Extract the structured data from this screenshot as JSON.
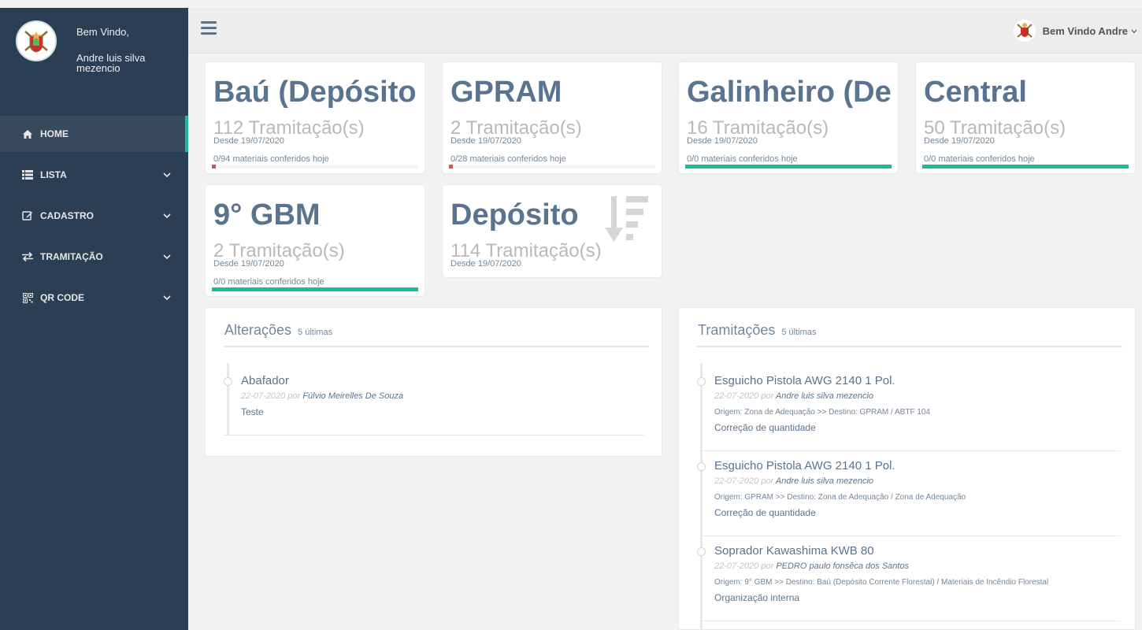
{
  "sidebar": {
    "welcome": "Bem Vindo,",
    "user_name": "Andre luis silva mezencio",
    "menu": [
      {
        "label": "HOME",
        "icon": "home-icon"
      },
      {
        "label": "LISTA",
        "icon": "list-icon"
      },
      {
        "label": "CADASTRO",
        "icon": "edit-icon"
      },
      {
        "label": "TRAMITAÇÃO",
        "icon": "exchange-icon"
      },
      {
        "label": "QR CODE",
        "icon": "qrcode-icon"
      }
    ]
  },
  "topbar": {
    "user_label": "Bem Vindo Andre"
  },
  "tiles": [
    {
      "title": "Baú (Depósito",
      "count": "112 Tramitação(s)",
      "since": "Desde 19/07/2020",
      "checked": "0/94 materiais conferidos hoje",
      "progress": 0.0
    },
    {
      "title": "GPRAM",
      "count": "2 Tramitação(s)",
      "since": "Desde 19/07/2020",
      "checked": "0/28 materiais conferidos hoje",
      "progress": 0.0
    },
    {
      "title": "Galinheiro (De",
      "count": "16 Tramitação(s)",
      "since": "Desde 19/07/2020",
      "checked": "0/0 materiais conferidos hoje",
      "progress": 1.0
    },
    {
      "title": "Central",
      "count": "50 Tramitação(s)",
      "since": "Desde 19/07/2020",
      "checked": "0/0 materiais conferidos hoje",
      "progress": 1.0
    },
    {
      "title": "9° GBM",
      "count": "2 Tramitação(s)",
      "since": "Desde 19/07/2020",
      "checked": "0/0 materiais conferidos hoje",
      "progress": 1.0
    },
    {
      "title": "Depósito",
      "count": "114 Tramitação(s)",
      "since": "Desde 19/07/2020",
      "icon": "sort-amount-desc-icon"
    }
  ],
  "colors": {
    "sidebar_bg": "#2a3f54",
    "accent": "#1abb9c",
    "danger": "#d9534f",
    "title": "#5a738e"
  },
  "alteracoes": {
    "title": "Alterações",
    "subtitle": "5 últimas",
    "items": [
      {
        "title": "Abafador",
        "date": "22-07-2020",
        "por": "por",
        "author": "Fúlvio Meirelles De Souza",
        "desc": "Teste"
      }
    ]
  },
  "tramitacoes": {
    "title": "Tramitações",
    "subtitle": "5 últimas",
    "items": [
      {
        "title": "Esguicho Pistola AWG 2140 1 Pol.",
        "date": "22-07-2020",
        "por": "por",
        "author": "Andre luis silva mezencio",
        "route": "Origem: Zona de Adequação >> Destino: GPRAM / ABTF 104",
        "desc": "Correção de quantidade"
      },
      {
        "title": "Esguicho Pistola AWG 2140 1 Pol.",
        "date": "22-07-2020",
        "por": "por",
        "author": "Andre luis silva mezencio",
        "route": "Origem: GPRAM >> Destino: Zona de Adequação / Zona de Adequação",
        "desc": "Correção de quantidade"
      },
      {
        "title": "Soprador Kawashima KWB 80",
        "date": "22-07-2020",
        "por": "por",
        "author": "PEDRO paulo fonsêca dos Santos",
        "route": "Origem: 9° GBM >> Destino: Baú (Depósito Corrente Florestal) / Materiais de Incêndio Florestal",
        "desc": "Organização interna"
      }
    ]
  }
}
